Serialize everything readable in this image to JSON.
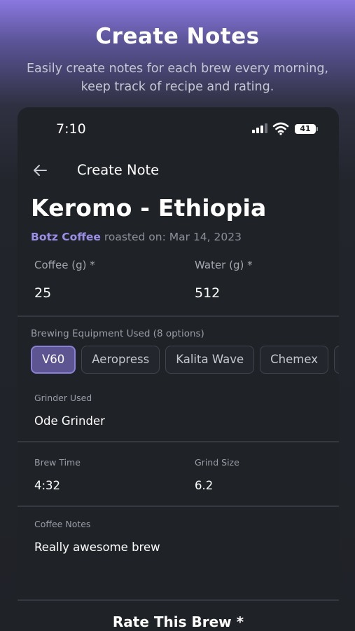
{
  "promo": {
    "title": "Create Notes",
    "subtitle_line1": "Easily create notes for each brew every morning,",
    "subtitle_line2": "keep track of recipe and rating."
  },
  "status_bar": {
    "time": "7:10",
    "battery": "41"
  },
  "nav": {
    "title": "Create Note"
  },
  "coffee": {
    "name": "Keromo - Ethiopia",
    "roaster": "Botz Coffee",
    "roasted_on": "roasted on: Mar 14, 2023"
  },
  "recipe": {
    "coffee_label": "Coffee (g) *",
    "coffee_value": "25",
    "water_label": "Water (g) *",
    "water_value": "512"
  },
  "equipment": {
    "label": "Brewing Equipment Used (8 options)",
    "options": [
      "V60",
      "Aeropress",
      "Kalita Wave",
      "Chemex",
      ""
    ],
    "selected": "V60"
  },
  "grinder": {
    "label": "Grinder Used",
    "value": "Ode Grinder"
  },
  "brew": {
    "time_label": "Brew Time",
    "time_value": "4:32",
    "grind_label": "Grind Size",
    "grind_value": "6.2"
  },
  "notes": {
    "label": "Coffee Notes",
    "value": "Really awesome brew"
  },
  "rating": {
    "title": "Rate This Brew *"
  },
  "colors": {
    "accent": "#9a8ee6",
    "chip_selected": "#5d5591",
    "background": "#1f2227"
  }
}
